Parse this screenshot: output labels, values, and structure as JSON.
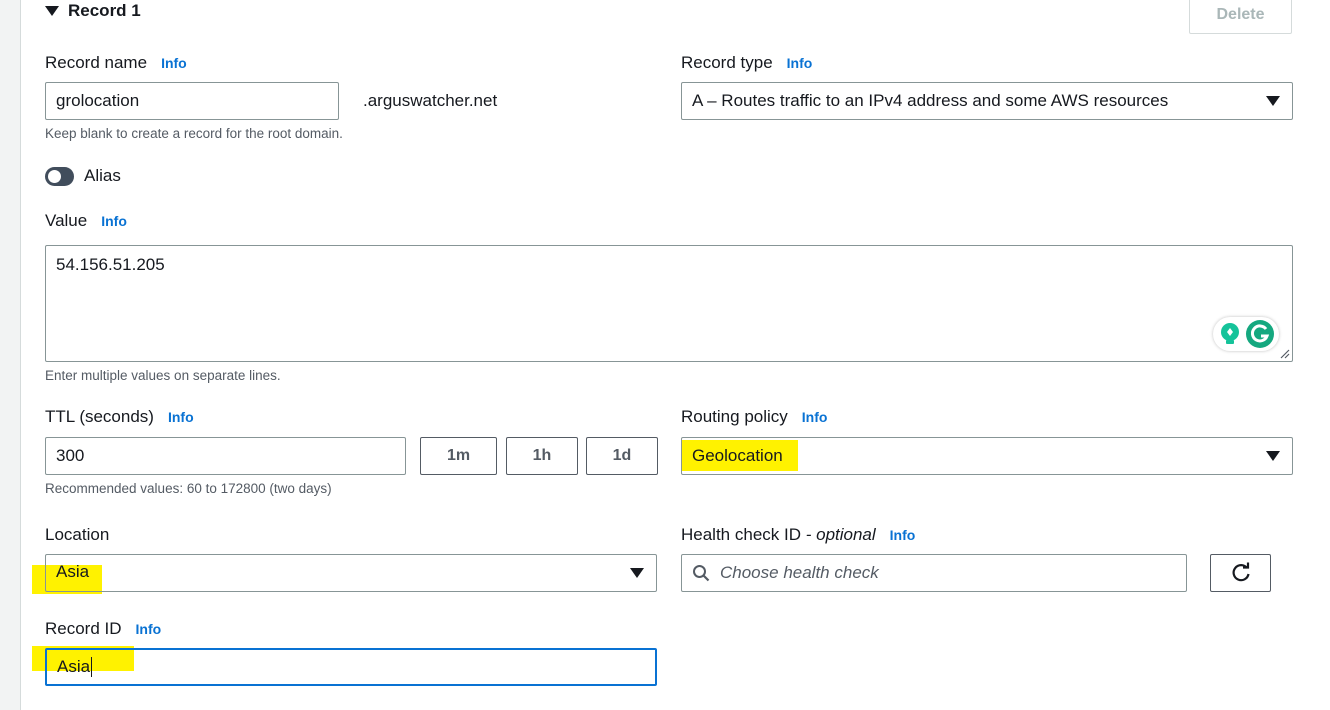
{
  "record": {
    "section_title": "Record 1",
    "delete_label": "Delete"
  },
  "info_label": "Info",
  "record_name": {
    "label": "Record name",
    "value": "grolocation",
    "domain_suffix": ".arguswatcher.net",
    "hint": "Keep blank to create a record for the root domain."
  },
  "record_type": {
    "label": "Record type",
    "value": "A – Routes traffic to an IPv4 address and some AWS resources"
  },
  "alias": {
    "label": "Alias",
    "enabled": false
  },
  "value_field": {
    "label": "Value",
    "value": "54.156.51.205",
    "hint": "Enter multiple values on separate lines."
  },
  "ttl": {
    "label": "TTL (seconds)",
    "value": "300",
    "presets": [
      "1m",
      "1h",
      "1d"
    ],
    "hint": "Recommended values: 60 to 172800 (two days)"
  },
  "routing_policy": {
    "label": "Routing policy",
    "value": "Geolocation"
  },
  "location": {
    "label": "Location",
    "value": "Asia"
  },
  "health_check": {
    "label": "Health check ID",
    "label_suffix": "- optional",
    "placeholder": "Choose health check"
  },
  "record_id": {
    "label": "Record ID",
    "value": "Asia"
  },
  "colors": {
    "link": "#0972d3",
    "highlight": "#fff200",
    "focus_border": "#0972d3",
    "grammarly": "#15c39a"
  },
  "icons": [
    "caret-down-icon",
    "search-icon",
    "refresh-icon",
    "grammarly-icon",
    "lightbulb-icon",
    "resize-handle-icon"
  ]
}
